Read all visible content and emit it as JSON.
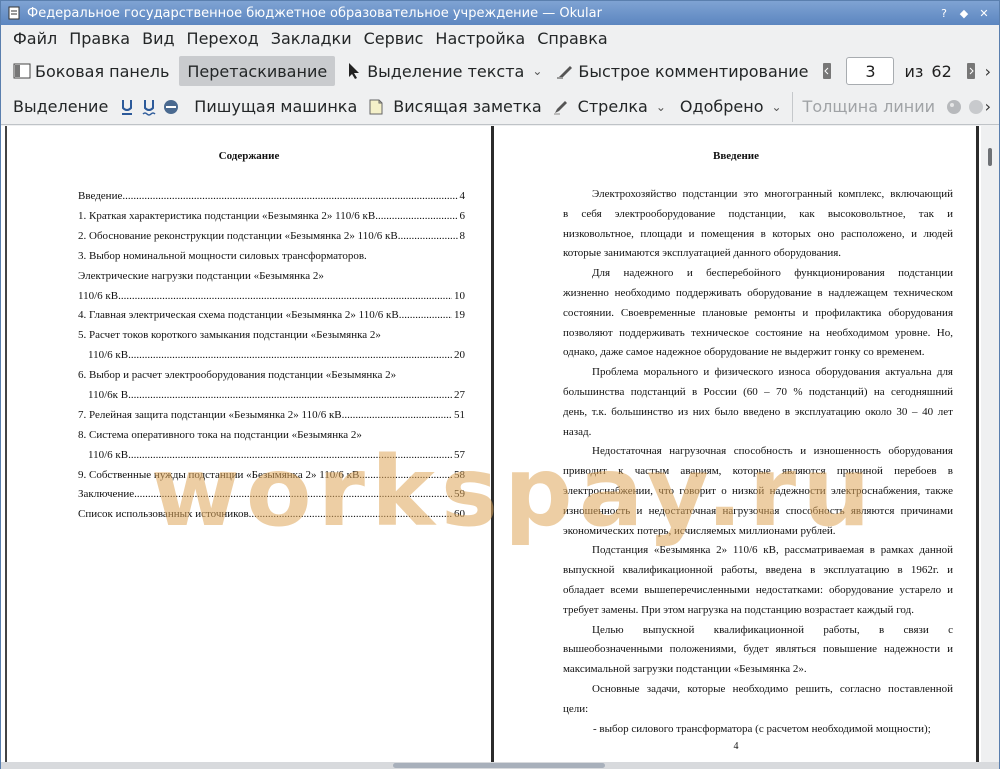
{
  "window": {
    "title": "Федеральное государственное бюджетное образовательное учреждение  — Okular",
    "icon": "okular-icon"
  },
  "menu": [
    "Файл",
    "Правка",
    "Вид",
    "Переход",
    "Закладки",
    "Сервис",
    "Настройка",
    "Справка"
  ],
  "toolbar1": {
    "sidebar": "Боковая панель",
    "drag": "Перетаскивание",
    "text_select": "Выделение текста",
    "quick_comment": "Быстрое комментирование",
    "page_current": "3",
    "page_of": "из",
    "page_total": "62"
  },
  "toolbar2": {
    "highlight": "Выделение",
    "typewriter": "Пишущая машинка",
    "sticky_note": "Висящая заметка",
    "arrow": "Стрелка",
    "stamp": "Одобрено",
    "line_width": "Толщина линии"
  },
  "toc": {
    "title": "Содержание",
    "entries": [
      {
        "text": "Введение",
        "page": "4"
      },
      {
        "text": "1. Краткая характеристика подстанции «Безымянка 2» 110/6 кВ",
        "page": "6"
      },
      {
        "text": "2. Обоснование реконструкции подстанции «Безымянка 2» 110/6 кВ",
        "page": "8"
      },
      {
        "text": "3. Выбор номинальной мощности силовых трансформаторов.",
        "page": ""
      },
      {
        "text": "Электрические нагрузки подстанции «Безымянка 2»",
        "page": ""
      },
      {
        "text": "110/6 кВ",
        "page": "10"
      },
      {
        "text": "4. Главная электрическая схема подстанции «Безымянка 2» 110/6 кВ",
        "page": "19"
      },
      {
        "text": "5. Расчет токов короткого замыкания подстанции «Безымянка 2»",
        "page": ""
      },
      {
        "text": "110/6 кВ.",
        "page": "20"
      },
      {
        "text": "6. Выбор и расчет электрооборудования подстанции «Безымянка 2»",
        "page": ""
      },
      {
        "text": "110/6к В",
        "page": "27"
      },
      {
        "text": "7. Релейная защита подстанции «Безымянка 2» 110/6 кВ",
        "page": "51"
      },
      {
        "text": "8. Система оперативного тока на подстанции «Безымянка 2»",
        "page": ""
      },
      {
        "text": "110/6 кВ",
        "page": "57"
      },
      {
        "text": "9. Собственные нужды подстанции «Безымянка 2» 110/6 кВ",
        "page": "58"
      },
      {
        "text": "Заключение",
        "page": "59"
      },
      {
        "text": "Список использованных источников",
        "page": "60"
      }
    ]
  },
  "intro": {
    "title": "Введение",
    "lines": [
      "Электрохозяйство подстанции это многогранный комплекс, включающий",
      "в себя электрооборудование подстанции, как высоковольтное, так и",
      "низковольтное, площади и помещения в которых оно расположено, и людей",
      "которые занимаются эксплуатацией данного оборудования.",
      "Для надежного и бесперебойного функционирования подстанции",
      "жизненно необходимо поддерживать оборудование в надлежащем техническом",
      "состоянии. Своевременные плановые ремонты и профилактика оборудования",
      "позволяют поддерживать техническое состояние на необходимом уровне. Но,",
      "однако, даже самое надежное оборудование не выдержит гонку со временем.",
      "Проблема морального и физического износа оборудования актуальна для",
      "большинства подстанций в России (60 – 70 % подстанций) на сегодняшний",
      "день, т.к. большинство из них было введено в эксплуатацию около 30 – 40 лет",
      "назад.",
      "Недостаточная нагрузочная способность и изношенность оборудования",
      "приводит к частым авариям, которые являются причиной перебоев в",
      "электроснабжении, что говорит о низкой надежности электроснабжения, также",
      "изношенность и недостаточная нагрузочная способность являются причинами",
      "экономических потерь, исчисляемых миллионами рублей.",
      "Подстанция «Безымянка 2» 110/6 кВ, рассматриваемая в рамках данной",
      "выпускной квалификационной работы, введена в эксплуатацию в 1962г. и",
      "обладает всеми вышеперечисленными недостатками: оборудование устарело и",
      "требует замены. При этом нагрузка на подстанцию возрастает каждый год.",
      "Целью выпускной квалификационной работы, в связи с",
      "вышеобозначенными положениями, будет являться повышение надежности и",
      "максимальной загрузки подстанции «Безымянка 2».",
      "Основные задачи, которые необходимо решить, согласно поставленной",
      "цели:",
      "- выбор силового трансформатора (с расчетом необходимой мощности);"
    ],
    "page_number": "4"
  },
  "watermark": "workspay.ru"
}
